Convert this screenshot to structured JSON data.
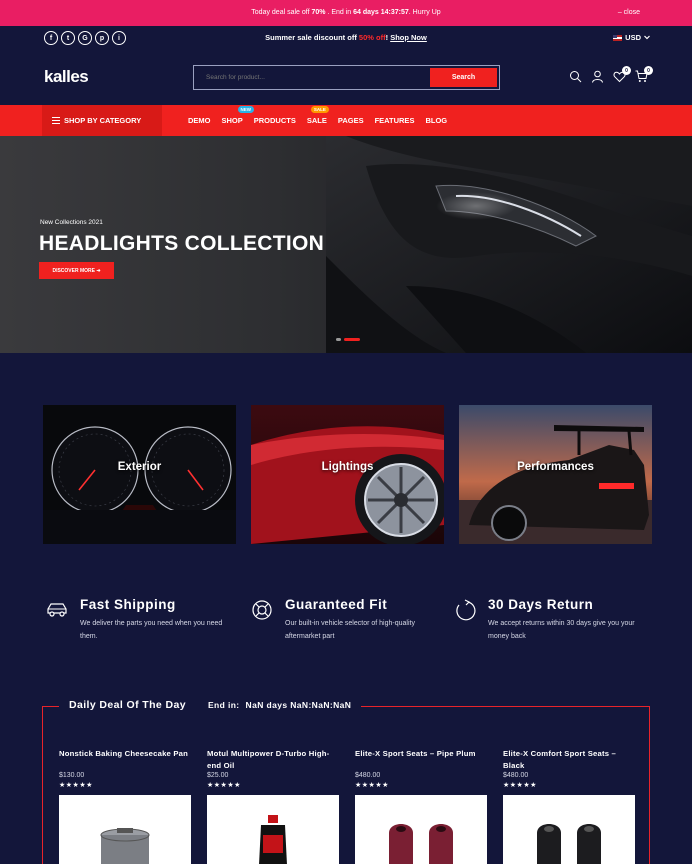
{
  "topbar": {
    "prefix": "Today deal sale off ",
    "percent": "70%",
    "mid": " . End in ",
    "countdown": "64 days 14:37:57",
    "suffix": ". Hurry Up",
    "close": "– close"
  },
  "utility": {
    "socials": [
      "f",
      "t",
      "G",
      "p",
      "i"
    ],
    "promo_prefix": "Summer sale discount off ",
    "promo_percent": "50% off",
    "promo_bang": "! ",
    "promo_link": "Shop Now",
    "currency": "USD"
  },
  "header": {
    "logo": "kalles",
    "search_placeholder": "Search for product...",
    "search_button": "Search",
    "wishlist_count": "0",
    "cart_count": "0"
  },
  "nav": {
    "category_label": "SHOP BY CATEGORY",
    "items": [
      {
        "label": "DEMO",
        "badge": ""
      },
      {
        "label": "SHOP",
        "badge": "NEW"
      },
      {
        "label": "PRODUCTS",
        "badge": ""
      },
      {
        "label": "SALE",
        "badge": "SALE"
      },
      {
        "label": "PAGES",
        "badge": ""
      },
      {
        "label": "FEATURES",
        "badge": ""
      },
      {
        "label": "BLOG",
        "badge": ""
      }
    ]
  },
  "hero": {
    "kicker": "New Collections 2021",
    "title": "HEADLIGHTS COLLECTION",
    "cta": "DISCOVER MORE ➜",
    "slides": 2,
    "active_slide": 2
  },
  "categories": [
    {
      "label": "Exterior"
    },
    {
      "label": "Lightings"
    },
    {
      "label": "Performances"
    }
  ],
  "features": [
    {
      "title": "Fast Shipping",
      "desc": "We deliver the parts you need when you need them.",
      "icon": "car-icon"
    },
    {
      "title": "Guaranteed Fit",
      "desc": "Our built-in vehicle selector of high-quality aftermarket part",
      "icon": "lifebuoy-icon"
    },
    {
      "title": "30 Days Return",
      "desc": "We accept returns within 30 days give you your money back",
      "icon": "return-icon"
    }
  ],
  "deal": {
    "title": "Daily Deal Of The Day",
    "end_in_label": "End in:",
    "countdown": "NaN days NaN:NaN:NaN",
    "products": [
      {
        "name": "Nonstick Baking Cheesecake Pan",
        "price": "$130.00",
        "stars": "★★★★★"
      },
      {
        "name": "Motul Multipower D-Turbo High-end Oil",
        "price": "$25.00",
        "stars": "★★★★★"
      },
      {
        "name": "Elite-X Sport Seats – Pipe Plum",
        "price": "$480.00",
        "stars": "★★★★★"
      },
      {
        "name": "Elite-X Comfort Sport Seats – Black",
        "price": "$480.00",
        "stars": "★★★★★"
      }
    ]
  },
  "colors": {
    "background": "#13163a",
    "topbar": "#e91e63",
    "accent": "#f0211f"
  }
}
